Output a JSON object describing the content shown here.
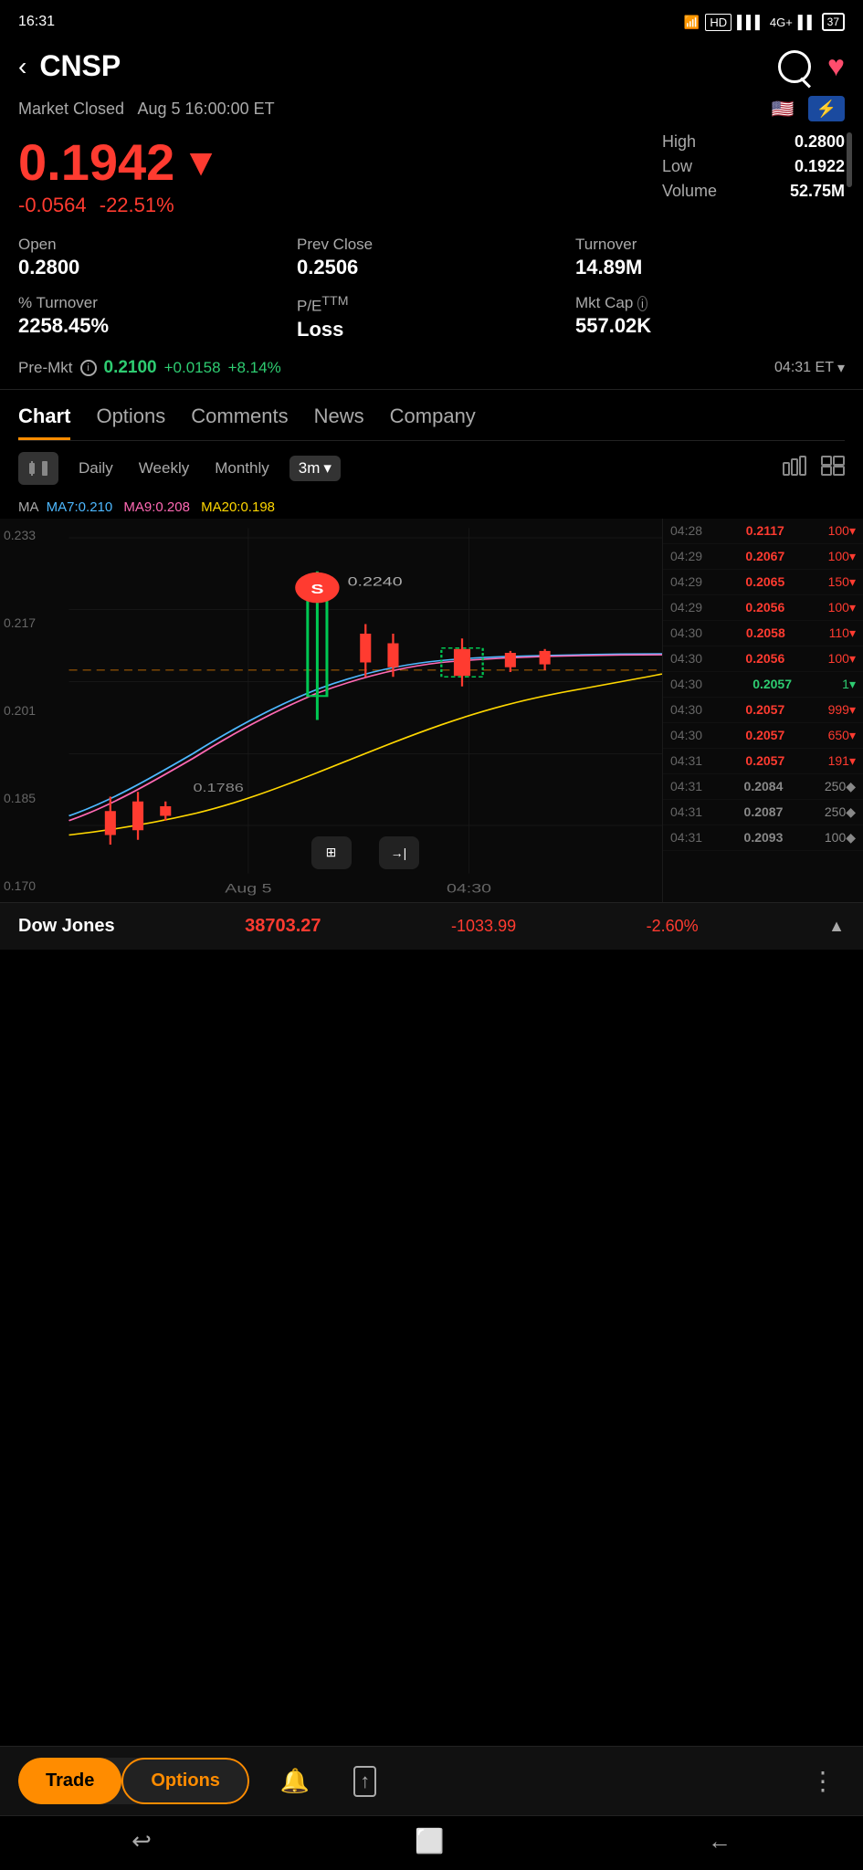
{
  "statusBar": {
    "time": "16:31",
    "battery": "37"
  },
  "header": {
    "ticker": "CNSP",
    "backLabel": "‹",
    "searchLabel": "⌕",
    "heartLabel": "♥"
  },
  "market": {
    "status": "Market Closed",
    "datetime": "Aug 5 16:00:00 ET"
  },
  "price": {
    "current": "0.1942",
    "change": "-0.0564",
    "changePct": "-22.51%",
    "high": "0.2800",
    "low": "0.1922",
    "volume": "52.75M"
  },
  "stats": {
    "open": {
      "label": "Open",
      "value": "0.2800"
    },
    "prevClose": {
      "label": "Prev Close",
      "value": "0.2506"
    },
    "turnover": {
      "label": "Turnover",
      "value": "14.89M"
    },
    "pctTurnover": {
      "label": "% Turnover",
      "value": "2258.45%"
    },
    "pe": {
      "label": "P/E TTM",
      "value": "Loss"
    },
    "mktCap": {
      "label": "Mkt Cap",
      "value": "557.02K"
    }
  },
  "premarket": {
    "label": "Pre-Mkt",
    "price": "0.2100",
    "change": "+0.0158",
    "changePct": "+8.14%",
    "time": "04:31 ET"
  },
  "tabs": [
    {
      "label": "Chart",
      "active": true
    },
    {
      "label": "Options",
      "active": false
    },
    {
      "label": "Comments",
      "active": false
    },
    {
      "label": "News",
      "active": false
    },
    {
      "label": "Company",
      "active": false
    }
  ],
  "chartControls": {
    "timeframes": [
      "Daily",
      "Weekly",
      "Monthly"
    ],
    "selected": "3m"
  },
  "ma": {
    "label": "MA",
    "ma7": "MA7:0.210",
    "ma9": "MA9:0.208",
    "ma20": "MA20:0.198"
  },
  "chartYLabels": [
    "0.233",
    "0.217",
    "0.201",
    "0.185",
    "0.170"
  ],
  "chartXLabels": [
    "Aug 5",
    "04:30"
  ],
  "chartAnnotation": {
    "label": "S",
    "price": "0.2240"
  },
  "chartPriceLevel": "0.1786",
  "trades": [
    {
      "time": "04:28",
      "price": "0.2117",
      "vol": "100",
      "color": "red"
    },
    {
      "time": "04:29",
      "price": "0.2067",
      "vol": "100",
      "color": "red"
    },
    {
      "time": "04:29",
      "price": "0.2065",
      "vol": "150",
      "color": "red"
    },
    {
      "time": "04:29",
      "price": "0.2056",
      "vol": "100",
      "color": "red"
    },
    {
      "time": "04:30",
      "price": "0.2058",
      "vol": "110",
      "color": "red"
    },
    {
      "time": "04:30",
      "price": "0.2056",
      "vol": "100",
      "color": "red"
    },
    {
      "time": "04:30",
      "price": "0.2057",
      "vol": "1",
      "color": "green"
    },
    {
      "time": "04:30",
      "price": "0.2057",
      "vol": "999",
      "color": "red"
    },
    {
      "time": "04:30",
      "price": "0.2057",
      "vol": "650",
      "color": "red"
    },
    {
      "time": "04:31",
      "price": "0.2057",
      "vol": "191",
      "color": "red"
    },
    {
      "time": "04:31",
      "price": "0.2084",
      "vol": "250",
      "color": "gray"
    },
    {
      "time": "04:31",
      "price": "0.2087",
      "vol": "250",
      "color": "gray"
    },
    {
      "time": "04:31",
      "price": "0.2093",
      "vol": "100",
      "color": "gray"
    }
  ],
  "dowJones": {
    "name": "Dow Jones",
    "price": "38703.27",
    "change": "-1033.99",
    "changePct": "-2.60%"
  },
  "bottomBar": {
    "tradeLabel": "Trade",
    "optionsLabel": "Options",
    "alertIcon": "🔔",
    "shareIcon": "↑",
    "moreIcon": "⋮"
  },
  "navBar": {
    "back": "↩",
    "home": "⬜",
    "forward": "←"
  }
}
